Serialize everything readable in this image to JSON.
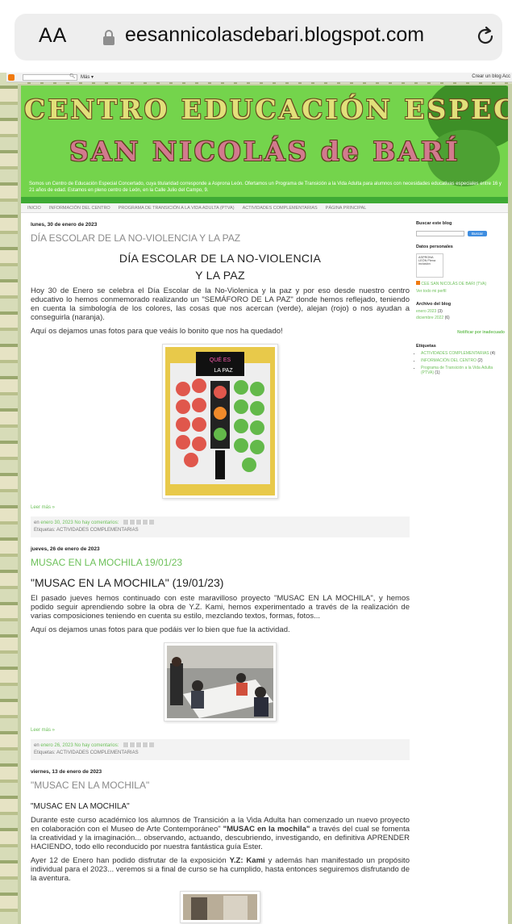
{
  "browser": {
    "aa_label": "AA",
    "url": "eesannicolasdebari.blogspot.com"
  },
  "blogger_bar": {
    "more_label": "Más ▾",
    "right_label": "Crear un blog  Acc"
  },
  "header": {
    "title_line1": "CENTRO EDUCACIÓN ESPECIAL",
    "title_line2": "SAN NICOLÁS de BARÍ",
    "description": "Somos un Centro de Educación Especial Concertado, cuya titularidad corresponde a Asprona León. Ofertamos un Programa de Transición a la Vida Adulta para alumnos con necesidades educativas especiales entre 16 y 21 años de edad. Estamos en pleno centro de León, en la Calle Julio del Campo, 9.",
    "colors": {
      "banner": "#74d44c",
      "footer": "#3faa35"
    }
  },
  "tabs": [
    {
      "label": "INICIO"
    },
    {
      "label": "INFORMACIÓN DEL CENTRO"
    },
    {
      "label": "PROGRAMA DE TRANSICIÓN A LA VIDA ADULTA (PTVA)"
    },
    {
      "label": "ACTIVIDADES COMPLEMENTARIAS"
    },
    {
      "label": "PÁGINA PRINCIPAL"
    }
  ],
  "posts": [
    {
      "date": "lunes, 30 de enero de 2023",
      "title": "DÍA ESCOLAR DE LA NO-VIOLENCIA Y LA PAZ",
      "heading_line1": "DÍA ESCOLAR DE LA NO-VIOLENCIA",
      "heading_line2": "Y LA PAZ",
      "para1": "Hoy 30 de Enero se celebra el Día Escolar de la No-Violenica y la paz y por eso desde nuestro centro educativo lo hemos conmemorado realizando un \"SEMÁFORO DE LA PAZ\" donde hemos reflejado, teniendo en cuenta la simbología de los colores, las cosas que nos acercan (verde), alejan (rojo) o nos ayudan a conseguirla (naranja).",
      "para2": "Aquí os dejamos unas fotos para que veáis lo bonito que nos ha quedado!",
      "photo_sign_top": "QUÉ ES",
      "photo_sign_bottom": "LA PAZ",
      "read_more": "Leer más »",
      "meta_prefix": "en",
      "meta_date": "enero 30, 2023",
      "meta_comments": "No hay comentarios:",
      "labels_prefix": "Etiquetas:",
      "labels": "ACTIVIDADES COMPLEMENTARIAS"
    },
    {
      "date": "jueves, 26 de enero de 2023",
      "title": "MUSAC EN LA MOCHILA 19/01/23",
      "heading": "\"MUSAC EN LA MOCHILA\" (19/01/23)",
      "para1": "El pasado jueves hemos continuado con este maravilloso proyecto \"MUSAC EN LA MOCHILA\", y hemos podido seguir aprendiendo sobre la obra de Y.Z. Kami, hemos experimentado a través de la realización de varias composiciones teniendo en cuenta su estilo, mezclando textos, formas, fotos...",
      "para2": "Aquí os dejamos unas fotos para que podáis ver lo bien que fue la actividad.",
      "read_more": "Leer más »",
      "meta_prefix": "en",
      "meta_date": "enero 26, 2023",
      "meta_comments": "No hay comentarios:",
      "labels_prefix": "Etiquetas:",
      "labels": "ACTIVIDADES COMPLEMENTARIAS"
    },
    {
      "date": "viernes, 13 de enero de 2023",
      "title": "\"MUSAC EN LA MOCHILA\"",
      "heading": "\"MUSAC EN LA MOCHILA\"",
      "para1_a": "Durante este curso académico los alumnos de Transición a la Vida Adulta han comenzado un nuevo proyecto en colaboración con el Museo de Arte Contemporáneo\" ",
      "para1_b": "\"MUSAC en la mochila\"",
      "para1_c": " a través del cual se fomenta la creatividad y la imaginación... observando, actuando, descubriendo, investigando, en definitiva APRENDER HACIENDO, todo ello reconducido por nuestra fantástica guía Ester.",
      "para2_a": "Ayer 12 de Enero han podido disfrutar de la exposición ",
      "para2_b": "Y.Z: Kami",
      "para2_c": " y además han manifestado un propósito individual para el 2023... veremos si a final de curso se ha cumplido, hasta entonces seguiremos disfrutando de la aventura."
    }
  ],
  "sidebar": {
    "search_title": "Buscar este blog",
    "search_button": "Buscar",
    "profile_title": "Datos personales",
    "logo_text": "ASPRONA LEÓN Plena inclusión",
    "profile_name": "CEE SAN NICOLÁS DE BARI (TVA)",
    "profile_link": "Ver todo mi perfil",
    "archive_title": "Archivo del blog",
    "archive": [
      {
        "label": "enero 2023",
        "count": "(3)"
      },
      {
        "label": "diciembre 2022",
        "count": "(6)"
      }
    ],
    "notify_label": "Notificar por inadecuado",
    "labels_title": "Etiquetas",
    "labels": [
      {
        "label": "ACTIVIDADES COMPLEMENTARIAS",
        "count": "(4)"
      },
      {
        "label": "INFORMACIÓN DEL CENTRO",
        "count": "(2)"
      },
      {
        "label": "Programa de Transición a la Vida Adulta (PTVA)",
        "count": "(1)"
      }
    ]
  }
}
